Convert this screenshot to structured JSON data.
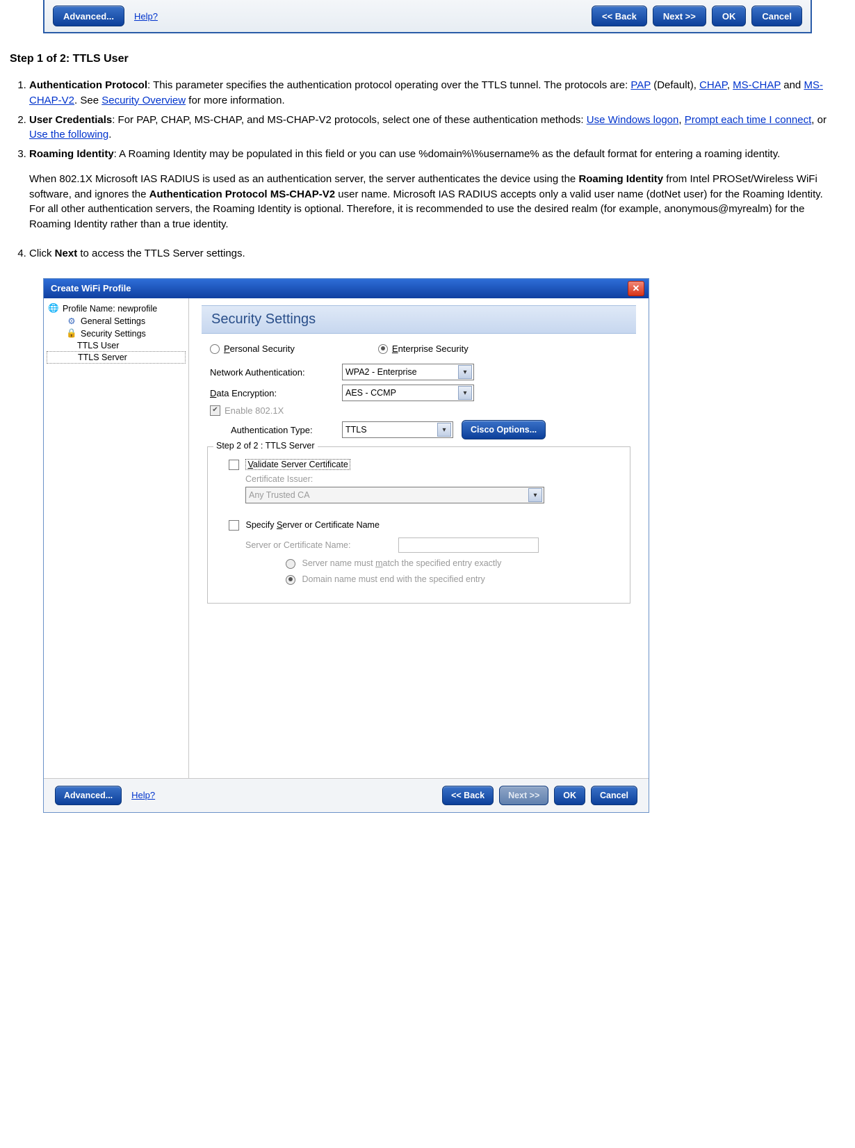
{
  "top_toolbar": {
    "advanced": "Advanced...",
    "help": "Help?",
    "back": "<< Back",
    "next": "Next >>",
    "ok": "OK",
    "cancel": "Cancel"
  },
  "heading": "Step 1 of 2: TTLS User",
  "list": {
    "item1_bold": "Authentication Protocol",
    "item1_text1": ": This parameter specifies the authentication protocol operating over the TTLS tunnel. The protocols are: ",
    "item1_link_pap": "PAP",
    "item1_text_default": " (Default), ",
    "item1_link_chap": "CHAP",
    "item1_sep1": ", ",
    "item1_link_mschap": "MS-CHAP",
    "item1_text_and": " and ",
    "item1_link_mschapv2": "MS-CHAP-V2",
    "item1_see": ". See ",
    "item1_link_sec": "Security Overview",
    "item1_more": " for more information.",
    "item2_bold": "User Credentials",
    "item2_text1": ": For PAP, CHAP, MS-CHAP, and MS-CHAP-V2 protocols, select one of these authentication methods: ",
    "item2_link_win": "Use Windows logon",
    "item2_sep1": ", ",
    "item2_link_prompt": "Prompt each time I connect",
    "item2_or": ", or ",
    "item2_link_follow": "Use the following",
    "item2_end": ".",
    "item3_bold": "Roaming Identity",
    "item3_text1": ": A Roaming Identity may be populated in this field or you can use %domain%\\%username% as the default format for entering a roaming identity.",
    "item3_para2a": "When 802.1X Microsoft IAS RADIUS is used as an authentication server, the server authenticates the device using the ",
    "item3_para2b_bold": "Roaming Identity",
    "item3_para2c": " from Intel PROSet/Wireless WiFi software, and ignores the ",
    "item3_para2d_bold": "Authentication Protocol MS-CHAP-V2",
    "item3_para2e": " user name. Microsoft IAS RADIUS accepts only a valid user name (dotNet user) for the Roaming Identity. For all other authentication servers, the Roaming Identity is optional. Therefore, it is recommended to use the desired realm (for example, anonymous@myrealm) for the Roaming Identity rather than a true identity.",
    "item4_a": "Click ",
    "item4_bold": "Next",
    "item4_b": " to access the TTLS Server settings."
  },
  "dialog": {
    "title": "Create WiFi Profile",
    "nav": {
      "profile_name": "Profile Name: newprofile",
      "general": "General Settings",
      "security": "Security Settings",
      "ttls_user": "TTLS User",
      "ttls_server": "TTLS Server"
    },
    "section_header": "Security Settings",
    "radio_personal": "Personal Security",
    "radio_enterprise": "Enterprise Security",
    "label_netauth": "Network Authentication:",
    "val_netauth": "WPA2 - Enterprise",
    "label_dataenc": "Data Encryption:",
    "val_dataenc": "AES - CCMP",
    "enable8021x": "Enable 802.1X",
    "label_authtype": "Authentication Type:",
    "val_authtype": "TTLS",
    "btn_cisco": "Cisco Options...",
    "group_title": "Step 2 of 2 : TTLS Server",
    "chk_validate": "Validate Server Certificate",
    "lbl_cert_issuer": "Certificate Issuer:",
    "val_cert_issuer": "Any Trusted CA",
    "chk_specify": "Specify Server or Certificate Name",
    "lbl_servername": "Server or Certificate Name:",
    "radio_match": "Server name must match the specified entry exactly",
    "radio_endwith": "Domain name must end with the specified entry",
    "footer": {
      "advanced": "Advanced...",
      "help": "Help?",
      "back": "<< Back",
      "next": "Next >>",
      "ok": "OK",
      "cancel": "Cancel"
    }
  }
}
